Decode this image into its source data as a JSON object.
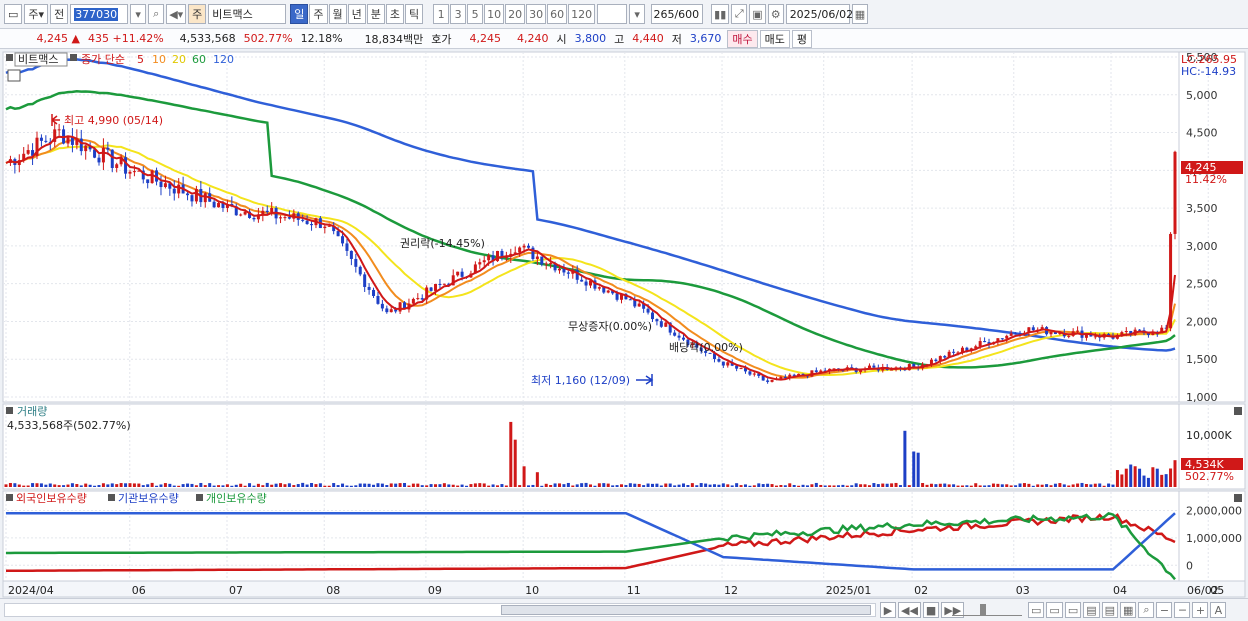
{
  "toolbar": {
    "period_type": "주",
    "prev_label": "전",
    "code": "377030",
    "name_prefix": "주",
    "stock_name": "비트맥스",
    "periods": [
      "일",
      "주",
      "월",
      "년",
      "분",
      "초",
      "틱"
    ],
    "active_period": "일",
    "intervals": [
      "1",
      "3",
      "5",
      "10",
      "20",
      "30",
      "60",
      "120"
    ],
    "count": "265",
    "count_total": "/600",
    "date": "2025/06/02"
  },
  "quote": {
    "price": "4,245",
    "change": "435",
    "change_pct": "+11.42%",
    "volume": "4,533,568",
    "volume_pct": "502.77%",
    "turnover": "12.18%",
    "amount": "18,834백만",
    "hoga_label": "호가",
    "ask": "4,245",
    "bid": "4,240",
    "open_label": "시",
    "open": "3,800",
    "high_label": "고",
    "high": "4,440",
    "low_label": "저",
    "low": "3,670",
    "buy_label": "매수",
    "sell_label": "매도",
    "avg_label": "평"
  },
  "price_panel": {
    "legend_name": "비트맥스",
    "legend_ma_title": "종가 단순",
    "ma_periods": [
      "5",
      "10",
      "20",
      "60",
      "120"
    ],
    "lc": "LC:265.95",
    "hc": "HC:-14.93",
    "y_ticks": [
      "5,500",
      "5,000",
      "4,500",
      "4,000",
      "3,500",
      "3,000",
      "2,500",
      "2,000",
      "1,500",
      "1,000"
    ],
    "last_price_tag": "4,245",
    "last_pct_tag": "11.42%",
    "annotations": {
      "high": "최고 4,990 (05/14)",
      "low": "최저 1,160 (12/09)",
      "rights": "권리락(-14.45%)",
      "bonus": "무상증자(0.00%)",
      "dividend": "배당락(0.00%)"
    }
  },
  "volume_panel": {
    "title": "거래량",
    "value": "4,533,568주(502.77%)",
    "y_tick": "10,000K",
    "last_tag": "4,534K",
    "last_pct": "502.77%"
  },
  "holdings_panel": {
    "series": [
      "외국인보유수량",
      "기관보유수량",
      "개인보유수량"
    ],
    "y_ticks": [
      "2,000,000",
      "1,000,000",
      "0"
    ]
  },
  "x_axis": {
    "labels": [
      "2024/04",
      "06",
      "07",
      "08",
      "09",
      "10",
      "11",
      "12",
      "2025/01",
      "02",
      "03",
      "04",
      "05",
      "06",
      "06/02"
    ]
  },
  "colors": {
    "up": "#d01818",
    "down": "#1d3fc6",
    "ma5": "#d01818",
    "ma10": "#f28c1e",
    "ma20": "#f4e41c",
    "ma60": "#1c9a3c",
    "ma120": "#2f5fd8"
  },
  "chart_data": [
    {
      "type": "line",
      "title": "비트맥스 일봉",
      "x": [
        "2024/04",
        "2024/05/14",
        "2024/06",
        "2024/07",
        "2024/08",
        "2024/09",
        "2024/10",
        "2024/11",
        "2024/12",
        "2024/12/09",
        "2025/01",
        "2025/02",
        "2025/03",
        "2025/04",
        "2025/05",
        "2025/06/02"
      ],
      "series": [
        {
          "name": "종가",
          "values": [
            4100,
            4500,
            4000,
            3500,
            3300,
            2100,
            3000,
            2300,
            1500,
            1200,
            1350,
            1400,
            1900,
            1800,
            1900,
            4245
          ]
        }
      ],
      "ylim": [
        1000,
        5500
      ]
    },
    {
      "type": "bar",
      "title": "거래량",
      "x": [
        "2024/10",
        "2025/02",
        "2025/05",
        "2025/06/02"
      ],
      "values": [
        11000,
        9500,
        3500,
        4534
      ],
      "ylabel": "K"
    },
    {
      "type": "line",
      "title": "보유수량",
      "x": [
        "2024/04",
        "2024/11",
        "2024/12",
        "2025/02",
        "2025/05",
        "2025/06"
      ],
      "series": [
        {
          "name": "외국인보유수량",
          "values": [
            -200000,
            -100000,
            700000,
            1300000,
            1800000,
            900000
          ]
        },
        {
          "name": "기관보유수량",
          "values": [
            1900000,
            1900000,
            300000,
            -150000,
            -150000,
            1900000
          ]
        },
        {
          "name": "개인보유수량",
          "values": [
            450000,
            500000,
            1000000,
            1500000,
            1800000,
            -450000
          ]
        }
      ],
      "ylim": [
        -500000,
        2200000
      ]
    }
  ]
}
